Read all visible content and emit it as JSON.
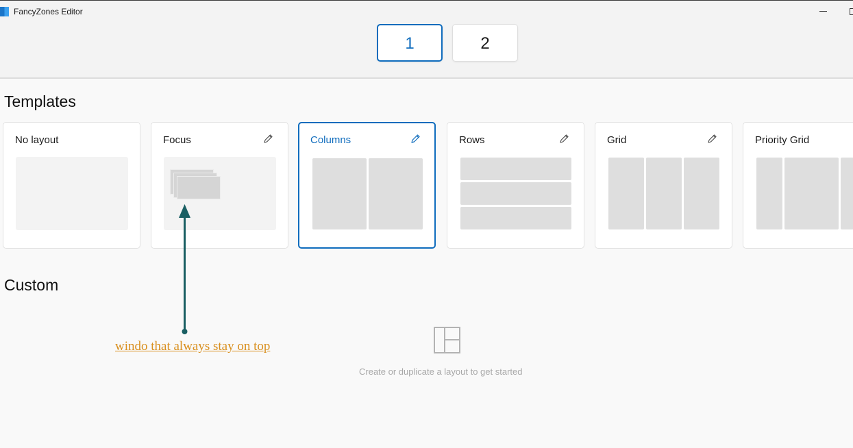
{
  "window": {
    "title": "FancyZones Editor",
    "app_icon": "fancyzones-icon",
    "controls": [
      "minimize-icon",
      "maximize-icon"
    ]
  },
  "monitors": [
    {
      "label": "1",
      "selected": true
    },
    {
      "label": "2",
      "selected": false
    }
  ],
  "templates": {
    "heading": "Templates",
    "items": [
      {
        "name": "No layout",
        "editable": false,
        "selected": false
      },
      {
        "name": "Focus",
        "editable": true,
        "selected": false
      },
      {
        "name": "Columns",
        "editable": true,
        "selected": true
      },
      {
        "name": "Rows",
        "editable": true,
        "selected": false
      },
      {
        "name": "Grid",
        "editable": true,
        "selected": false
      },
      {
        "name": "Priority Grid",
        "editable": false,
        "selected": false
      }
    ]
  },
  "custom": {
    "heading": "Custom",
    "empty_icon": "layout-icon",
    "empty_message": "Create or duplicate a layout to get started"
  },
  "annotation": {
    "text": "windo that always stay on top",
    "arrow_color": "#1a5f63",
    "text_color": "#d98f1e"
  },
  "colors": {
    "accent": "#0f6cbd",
    "zone": "#dedede",
    "background": "#f9f9f9"
  }
}
